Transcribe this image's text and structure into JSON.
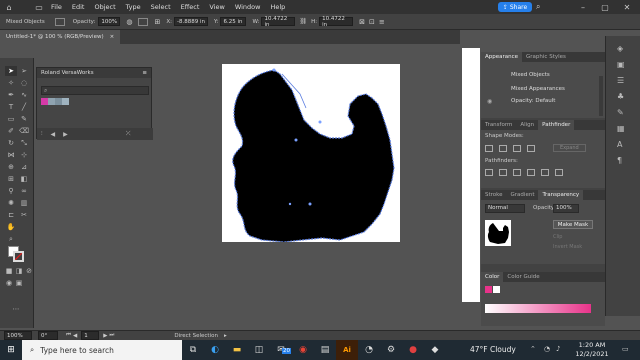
{
  "menubar": {
    "items": [
      "File",
      "Edit",
      "Object",
      "Type",
      "Select",
      "Effect",
      "View",
      "Window",
      "Help"
    ],
    "share_label": "Share"
  },
  "controlbar": {
    "selection_label": "Mixed Objects",
    "opacity_label": "Opacity:",
    "opacity_value": "100%",
    "x_label": "X:",
    "x_value": "-8.8889 in",
    "y_label": "Y:",
    "y_value": "6.25 in",
    "w_label": "W:",
    "w_value": "10.4722 in",
    "h_label": "H:",
    "h_value": "10.4722 in"
  },
  "document": {
    "tab_title": "Untitled-1* @ 100 % (RGB/Preview)",
    "close_glyph": "×"
  },
  "roland_panel": {
    "title": "Roland VersaWorks"
  },
  "appearance_panel": {
    "tabs": [
      "Appearance",
      "Graphic Styles"
    ],
    "rows": [
      "Mixed Objects",
      "Mixed Appearances",
      "Opacity: Default"
    ]
  },
  "pathfinder_panel": {
    "tabs": [
      "Transform",
      "Align",
      "Pathfinder"
    ],
    "shape_modes_label": "Shape Modes:",
    "expand_label": "Expand",
    "pathfinders_label": "Pathfinders:"
  },
  "transparency_panel": {
    "tabs": [
      "Stroke",
      "Gradient",
      "Transparency"
    ],
    "blend_mode": "Normal",
    "opacity_label": "Opacity:",
    "opacity_value": "100%",
    "make_mask_label": "Make Mask",
    "clip_label": "Clip",
    "invert_label": "Invert Mask"
  },
  "color_panel": {
    "tabs": [
      "Color",
      "Color Guide"
    ]
  },
  "statusbar": {
    "zoom": "100%",
    "rotation": "0°",
    "artboard": "1",
    "tool": "Direct Selection"
  },
  "taskbar": {
    "search_placeholder": "Type here to search",
    "weather": "47°F  Cloudy",
    "time": "1:20 AM",
    "date": "12/2/2021",
    "badge": "20"
  },
  "colors": {
    "accent": "#2680eb",
    "gradient_start": "#ffffff",
    "gradient_end": "#e8338a"
  }
}
